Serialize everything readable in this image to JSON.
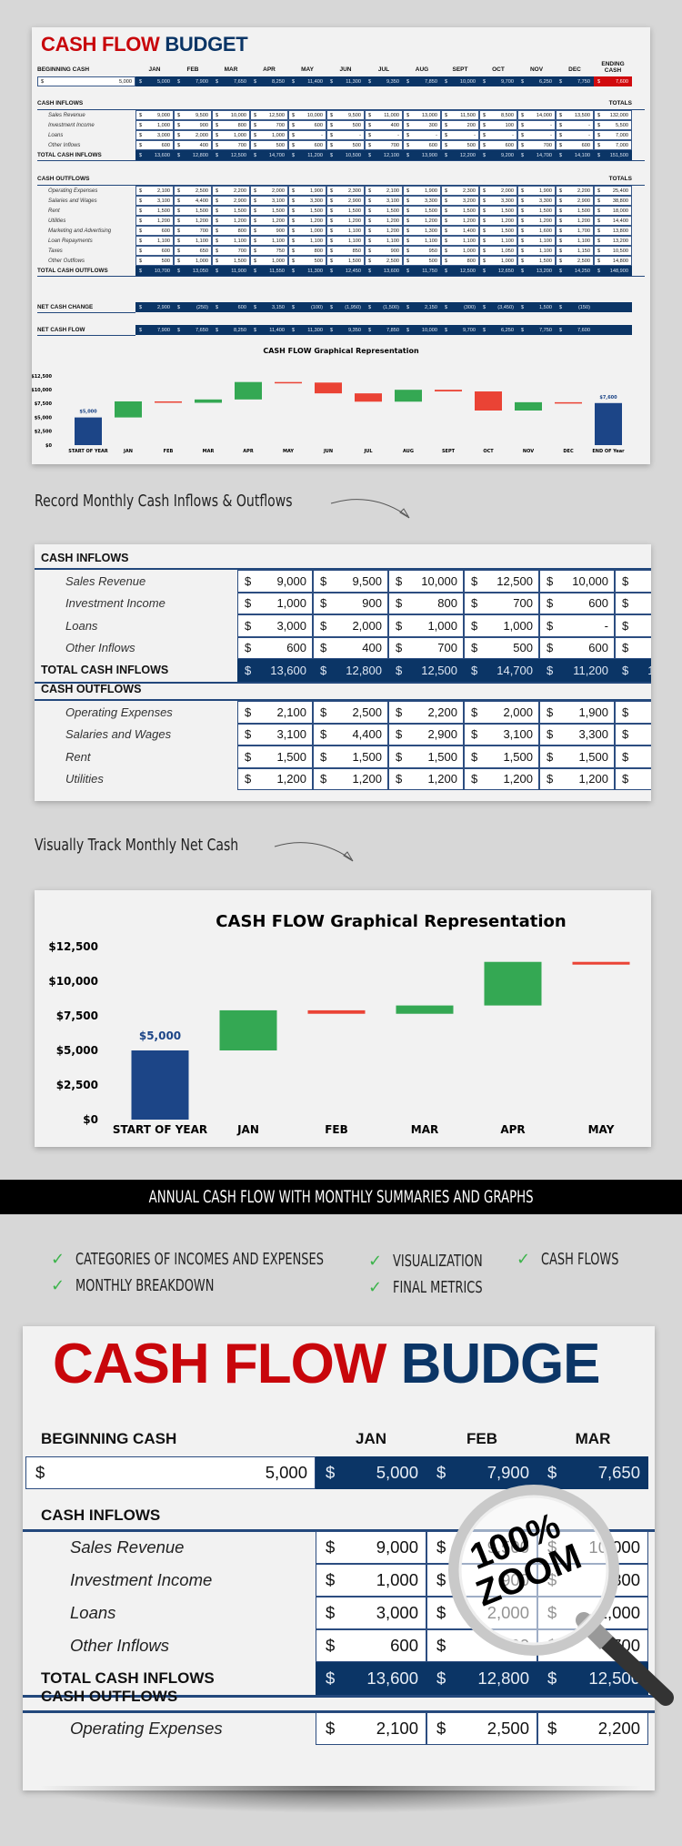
{
  "budget": {
    "title_part1": "CASH FLOW",
    "title_part2": "BUDGET",
    "title_cropped_part2": "BUDGE",
    "beginning_cash_label": "BEGINNING CASH",
    "beginning_cash_value": "5,000",
    "months": [
      "JAN",
      "FEB",
      "MAR",
      "APR",
      "MAY",
      "JUN",
      "JUL",
      "AUG",
      "SEPT",
      "OCT",
      "NOV",
      "DEC"
    ],
    "ending_cash_label": "ENDING CASH",
    "ending_cash_value": "7,600",
    "monthly_beginning": [
      "5,000",
      "7,900",
      "7,650",
      "8,250",
      "11,400",
      "11,300",
      "9,350",
      "7,850",
      "10,000",
      "9,700",
      "6,250",
      "7,750"
    ],
    "currency": "$",
    "totals_label": "TOTALS",
    "inflows": {
      "title": "CASH INFLOWS",
      "rows": [
        {
          "label": "Sales Revenue",
          "values": [
            "9,000",
            "9,500",
            "10,000",
            "12,500",
            "10,000",
            "9,500",
            "11,000",
            "13,000",
            "11,500",
            "8,500",
            "14,000",
            "13,500"
          ],
          "total": "132,000"
        },
        {
          "label": "Investment Income",
          "values": [
            "1,000",
            "900",
            "800",
            "700",
            "600",
            "500",
            "400",
            "300",
            "200",
            "100",
            "-",
            "-"
          ],
          "total": "5,500"
        },
        {
          "label": "Loans",
          "values": [
            "3,000",
            "2,000",
            "1,000",
            "1,000",
            "-",
            "-",
            "-",
            "-",
            "-",
            "-",
            "-",
            "-"
          ],
          "total": "7,000"
        },
        {
          "label": "Other Inflows",
          "values": [
            "600",
            "400",
            "700",
            "500",
            "600",
            "500",
            "700",
            "600",
            "500",
            "600",
            "700",
            "600"
          ],
          "total": "7,000"
        }
      ],
      "total_label": "TOTAL CASH INFLOWS",
      "total_values": [
        "13,600",
        "12,800",
        "12,500",
        "14,700",
        "11,200",
        "10,500",
        "12,100",
        "13,900",
        "12,200",
        "9,200",
        "14,700",
        "14,100"
      ],
      "grand_total": "151,500"
    },
    "outflows": {
      "title": "CASH OUTFLOWS",
      "rows": [
        {
          "label": "Operating Expenses",
          "values": [
            "2,100",
            "2,500",
            "2,200",
            "2,000",
            "1,900",
            "2,300",
            "2,100",
            "1,900",
            "2,300",
            "2,000",
            "1,900",
            "2,200"
          ],
          "total": "25,400"
        },
        {
          "label": "Salaries and Wages",
          "values": [
            "3,100",
            "4,400",
            "2,900",
            "3,100",
            "3,300",
            "2,900",
            "3,100",
            "3,300",
            "3,200",
            "3,300",
            "3,300",
            "2,900"
          ],
          "total": "38,800"
        },
        {
          "label": "Rent",
          "values": [
            "1,500",
            "1,500",
            "1,500",
            "1,500",
            "1,500",
            "1,500",
            "1,500",
            "1,500",
            "1,500",
            "1,500",
            "1,500",
            "1,500"
          ],
          "total": "18,000"
        },
        {
          "label": "Utilities",
          "values": [
            "1,200",
            "1,200",
            "1,200",
            "1,200",
            "1,200",
            "1,200",
            "1,200",
            "1,200",
            "1,200",
            "1,200",
            "1,200",
            "1,200"
          ],
          "total": "14,400"
        },
        {
          "label": "Marketing and Advertising",
          "values": [
            "600",
            "700",
            "800",
            "900",
            "1,000",
            "1,100",
            "1,200",
            "1,300",
            "1,400",
            "1,500",
            "1,600",
            "1,700"
          ],
          "total": "13,800"
        },
        {
          "label": "Loan Repayments",
          "values": [
            "1,100",
            "1,100",
            "1,100",
            "1,100",
            "1,100",
            "1,100",
            "1,100",
            "1,100",
            "1,100",
            "1,100",
            "1,100",
            "1,100"
          ],
          "total": "13,200"
        },
        {
          "label": "Taxes",
          "values": [
            "600",
            "650",
            "700",
            "750",
            "800",
            "850",
            "900",
            "950",
            "1,000",
            "1,050",
            "1,100",
            "1,150"
          ],
          "total": "10,500"
        },
        {
          "label": "Other Outflows",
          "values": [
            "500",
            "1,000",
            "1,500",
            "1,000",
            "500",
            "1,500",
            "2,500",
            "500",
            "800",
            "1,000",
            "1,500",
            "2,500"
          ],
          "total": "14,800"
        }
      ],
      "total_label": "TOTAL CASH OUTFLOWS",
      "total_values": [
        "10,700",
        "13,050",
        "11,900",
        "11,550",
        "11,300",
        "12,450",
        "13,600",
        "11,750",
        "12,500",
        "12,650",
        "13,200",
        "14,250"
      ],
      "grand_total": "148,900"
    },
    "net_change": {
      "label": "NET CASH CHANGE",
      "values": [
        "2,900",
        "(250)",
        "600",
        "3,150",
        "(100)",
        "(1,950)",
        "(1,500)",
        "2,150",
        "(300)",
        "(3,450)",
        "1,500",
        "(150)"
      ]
    },
    "net_flow": {
      "label": "NET CASH FLOW",
      "values": [
        "7,900",
        "7,650",
        "8,250",
        "11,400",
        "11,300",
        "9,350",
        "7,850",
        "10,000",
        "9,700",
        "6,250",
        "7,750",
        "7,600"
      ]
    }
  },
  "captions": {
    "record": "Record Monthly Cash Inflows & Outflows",
    "track": "Visually Track Monthly Net Cash"
  },
  "banner": "ANNUAL CASH FLOW  WITH MONTHLY SUMMARIES AND GRAPHS",
  "features": [
    "CATEGORIES OF INCOMES AND EXPENSES",
    "MONTHLY BREAKDOWN",
    "VISUALIZATION",
    "FINAL METRICS",
    "CASH FLOWS"
  ],
  "zoom_badge": {
    "line1": "100%",
    "line2": "ZOOM"
  },
  "colors": {
    "red": "#c8060b",
    "navy": "#0b3566",
    "increase": "#34a853",
    "decrease": "#ea4335",
    "bar": "#1c4587"
  },
  "chart_data": {
    "type": "bar",
    "subtype": "waterfall",
    "title": "CASH FLOW Graphical Representation",
    "categories": [
      "START OF YEAR",
      "JAN",
      "FEB",
      "MAR",
      "APR",
      "MAY",
      "JUN",
      "JUL",
      "AUG",
      "SEPT",
      "OCT",
      "NOV",
      "DEC",
      "END OF Year"
    ],
    "start_value": 5000,
    "changes": [
      2900,
      -250,
      600,
      3150,
      -100,
      -1950,
      -1500,
      2150,
      -300,
      -3450,
      1500,
      -150
    ],
    "end_value": 7600,
    "data_labels": {
      "START OF YEAR": "$5,000",
      "END OF Year": "$7,600"
    },
    "yticks": [
      "$0",
      "$2,500",
      "$5,000",
      "$7,500",
      "$10,000",
      "$12,500"
    ],
    "ylim": [
      0,
      12500
    ],
    "xlabel": "",
    "ylabel": "",
    "legend": "none",
    "grid": false
  }
}
